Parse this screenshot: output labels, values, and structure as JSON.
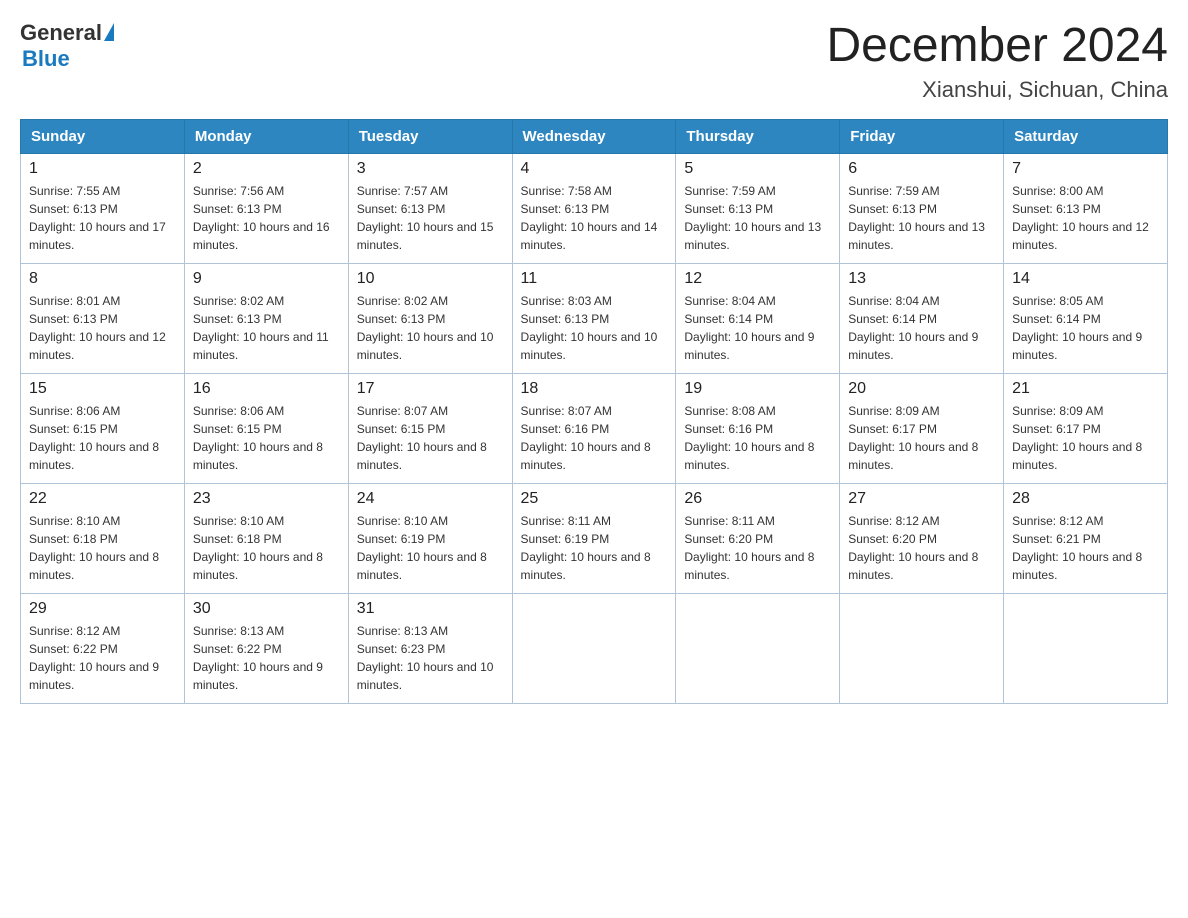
{
  "header": {
    "logo": {
      "general": "General",
      "blue": "Blue",
      "alt": "GeneralBlue logo"
    },
    "title": "December 2024",
    "subtitle": "Xianshui, Sichuan, China"
  },
  "calendar": {
    "headers": [
      "Sunday",
      "Monday",
      "Tuesday",
      "Wednesday",
      "Thursday",
      "Friday",
      "Saturday"
    ],
    "weeks": [
      [
        {
          "day": "1",
          "sunrise": "Sunrise: 7:55 AM",
          "sunset": "Sunset: 6:13 PM",
          "daylight": "Daylight: 10 hours and 17 minutes."
        },
        {
          "day": "2",
          "sunrise": "Sunrise: 7:56 AM",
          "sunset": "Sunset: 6:13 PM",
          "daylight": "Daylight: 10 hours and 16 minutes."
        },
        {
          "day": "3",
          "sunrise": "Sunrise: 7:57 AM",
          "sunset": "Sunset: 6:13 PM",
          "daylight": "Daylight: 10 hours and 15 minutes."
        },
        {
          "day": "4",
          "sunrise": "Sunrise: 7:58 AM",
          "sunset": "Sunset: 6:13 PM",
          "daylight": "Daylight: 10 hours and 14 minutes."
        },
        {
          "day": "5",
          "sunrise": "Sunrise: 7:59 AM",
          "sunset": "Sunset: 6:13 PM",
          "daylight": "Daylight: 10 hours and 13 minutes."
        },
        {
          "day": "6",
          "sunrise": "Sunrise: 7:59 AM",
          "sunset": "Sunset: 6:13 PM",
          "daylight": "Daylight: 10 hours and 13 minutes."
        },
        {
          "day": "7",
          "sunrise": "Sunrise: 8:00 AM",
          "sunset": "Sunset: 6:13 PM",
          "daylight": "Daylight: 10 hours and 12 minutes."
        }
      ],
      [
        {
          "day": "8",
          "sunrise": "Sunrise: 8:01 AM",
          "sunset": "Sunset: 6:13 PM",
          "daylight": "Daylight: 10 hours and 12 minutes."
        },
        {
          "day": "9",
          "sunrise": "Sunrise: 8:02 AM",
          "sunset": "Sunset: 6:13 PM",
          "daylight": "Daylight: 10 hours and 11 minutes."
        },
        {
          "day": "10",
          "sunrise": "Sunrise: 8:02 AM",
          "sunset": "Sunset: 6:13 PM",
          "daylight": "Daylight: 10 hours and 10 minutes."
        },
        {
          "day": "11",
          "sunrise": "Sunrise: 8:03 AM",
          "sunset": "Sunset: 6:13 PM",
          "daylight": "Daylight: 10 hours and 10 minutes."
        },
        {
          "day": "12",
          "sunrise": "Sunrise: 8:04 AM",
          "sunset": "Sunset: 6:14 PM",
          "daylight": "Daylight: 10 hours and 9 minutes."
        },
        {
          "day": "13",
          "sunrise": "Sunrise: 8:04 AM",
          "sunset": "Sunset: 6:14 PM",
          "daylight": "Daylight: 10 hours and 9 minutes."
        },
        {
          "day": "14",
          "sunrise": "Sunrise: 8:05 AM",
          "sunset": "Sunset: 6:14 PM",
          "daylight": "Daylight: 10 hours and 9 minutes."
        }
      ],
      [
        {
          "day": "15",
          "sunrise": "Sunrise: 8:06 AM",
          "sunset": "Sunset: 6:15 PM",
          "daylight": "Daylight: 10 hours and 8 minutes."
        },
        {
          "day": "16",
          "sunrise": "Sunrise: 8:06 AM",
          "sunset": "Sunset: 6:15 PM",
          "daylight": "Daylight: 10 hours and 8 minutes."
        },
        {
          "day": "17",
          "sunrise": "Sunrise: 8:07 AM",
          "sunset": "Sunset: 6:15 PM",
          "daylight": "Daylight: 10 hours and 8 minutes."
        },
        {
          "day": "18",
          "sunrise": "Sunrise: 8:07 AM",
          "sunset": "Sunset: 6:16 PM",
          "daylight": "Daylight: 10 hours and 8 minutes."
        },
        {
          "day": "19",
          "sunrise": "Sunrise: 8:08 AM",
          "sunset": "Sunset: 6:16 PM",
          "daylight": "Daylight: 10 hours and 8 minutes."
        },
        {
          "day": "20",
          "sunrise": "Sunrise: 8:09 AM",
          "sunset": "Sunset: 6:17 PM",
          "daylight": "Daylight: 10 hours and 8 minutes."
        },
        {
          "day": "21",
          "sunrise": "Sunrise: 8:09 AM",
          "sunset": "Sunset: 6:17 PM",
          "daylight": "Daylight: 10 hours and 8 minutes."
        }
      ],
      [
        {
          "day": "22",
          "sunrise": "Sunrise: 8:10 AM",
          "sunset": "Sunset: 6:18 PM",
          "daylight": "Daylight: 10 hours and 8 minutes."
        },
        {
          "day": "23",
          "sunrise": "Sunrise: 8:10 AM",
          "sunset": "Sunset: 6:18 PM",
          "daylight": "Daylight: 10 hours and 8 minutes."
        },
        {
          "day": "24",
          "sunrise": "Sunrise: 8:10 AM",
          "sunset": "Sunset: 6:19 PM",
          "daylight": "Daylight: 10 hours and 8 minutes."
        },
        {
          "day": "25",
          "sunrise": "Sunrise: 8:11 AM",
          "sunset": "Sunset: 6:19 PM",
          "daylight": "Daylight: 10 hours and 8 minutes."
        },
        {
          "day": "26",
          "sunrise": "Sunrise: 8:11 AM",
          "sunset": "Sunset: 6:20 PM",
          "daylight": "Daylight: 10 hours and 8 minutes."
        },
        {
          "day": "27",
          "sunrise": "Sunrise: 8:12 AM",
          "sunset": "Sunset: 6:20 PM",
          "daylight": "Daylight: 10 hours and 8 minutes."
        },
        {
          "day": "28",
          "sunrise": "Sunrise: 8:12 AM",
          "sunset": "Sunset: 6:21 PM",
          "daylight": "Daylight: 10 hours and 8 minutes."
        }
      ],
      [
        {
          "day": "29",
          "sunrise": "Sunrise: 8:12 AM",
          "sunset": "Sunset: 6:22 PM",
          "daylight": "Daylight: 10 hours and 9 minutes."
        },
        {
          "day": "30",
          "sunrise": "Sunrise: 8:13 AM",
          "sunset": "Sunset: 6:22 PM",
          "daylight": "Daylight: 10 hours and 9 minutes."
        },
        {
          "day": "31",
          "sunrise": "Sunrise: 8:13 AM",
          "sunset": "Sunset: 6:23 PM",
          "daylight": "Daylight: 10 hours and 10 minutes."
        },
        null,
        null,
        null,
        null
      ]
    ]
  }
}
